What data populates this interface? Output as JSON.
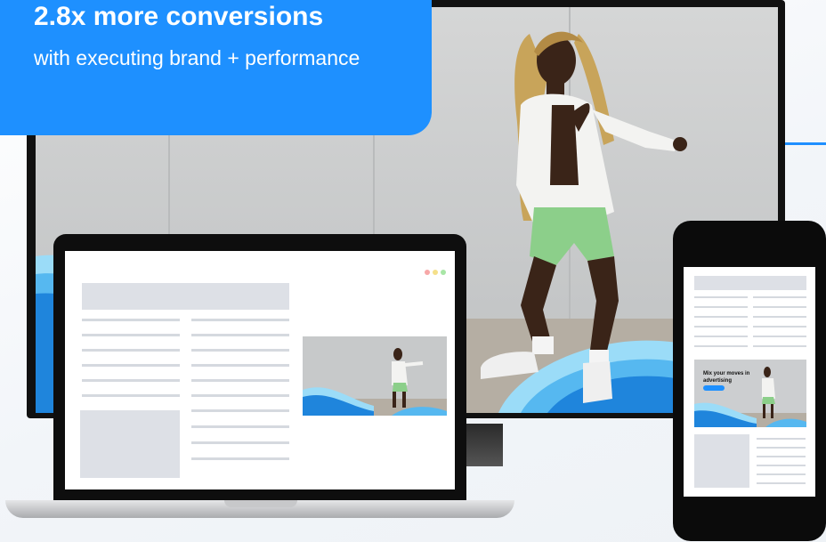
{
  "badge": {
    "title": "2.8x more conversions",
    "subtitle": "with executing brand + performance"
  },
  "phone_ad": {
    "headline": "Mix your moves in advertising"
  },
  "colors": {
    "brand_blue": "#1e90ff",
    "wave_light": "#7fd0f7",
    "wave_mid": "#35a8ee",
    "wave_dark": "#1679d6",
    "placeholder_gray": "#dde0e6",
    "dot_red": "#f7a8a8",
    "dot_yellow": "#f5e08a",
    "dot_green": "#a8e6a6"
  },
  "icons": [
    "window-dots-icon"
  ]
}
